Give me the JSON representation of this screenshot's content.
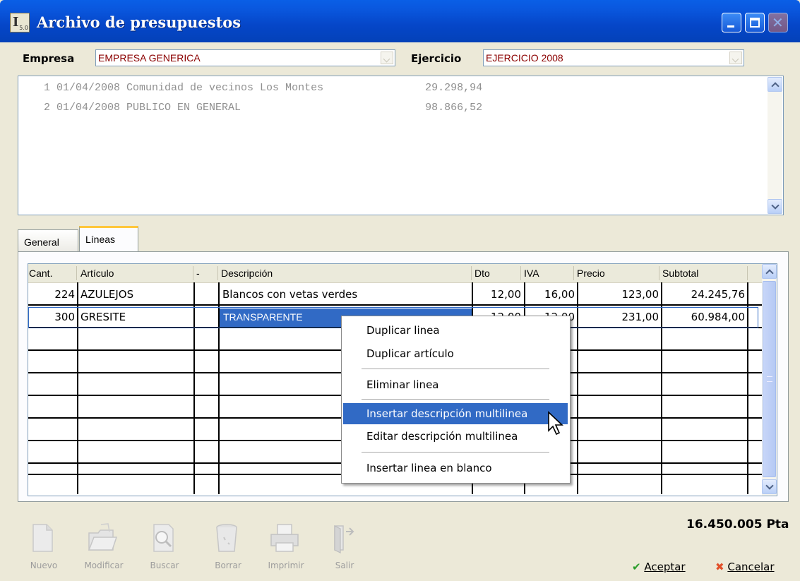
{
  "window": {
    "title": "Archivo de presupuestos",
    "app_icon_label": "I",
    "app_icon_badge": "5.0",
    "close_glyph": "✕"
  },
  "filters": {
    "empresa_label": "Empresa",
    "empresa_value": "EMPRESA GENERICA",
    "ejercicio_label": "Ejercicio",
    "ejercicio_value": "EJERCICIO 2008"
  },
  "budgets": [
    {
      "text": "    1 01/04/2008 Comunidad de vecinos Los Montes                29.298,94"
    },
    {
      "text": "    2 01/04/2008 PUBLICO EN GENERAL                             98.866,52"
    }
  ],
  "tabs": [
    {
      "label": "General",
      "active": false
    },
    {
      "label": "Líneas",
      "active": true
    }
  ],
  "grid": {
    "headers": [
      "Cant.",
      "Artículo",
      "-",
      "Descripción",
      "Dto",
      "IVA",
      "Precio",
      "Subtotal"
    ],
    "rows": [
      {
        "cant": "224",
        "articulo": "AZULEJOS",
        "descripcion": "Blancos con vetas verdes",
        "dto": "12,00",
        "iva": "16,00",
        "precio": "123,00",
        "subtotal": "24.245,76"
      },
      {
        "cant": "300",
        "articulo": "GRESITE",
        "descripcion": "TRANSPARENTE",
        "dto": "12,00",
        "iva": "12,00",
        "precio": "231,00",
        "subtotal": "60.984,00"
      }
    ]
  },
  "context_menu": {
    "items": [
      {
        "label": "Duplicar linea"
      },
      {
        "label": "Duplicar artículo"
      },
      {
        "label": "Eliminar linea"
      },
      {
        "label": "Insertar descripción multilinea",
        "highlighted": true
      },
      {
        "label": "Editar descripción multilinea"
      },
      {
        "label": "Insertar linea en blanco"
      }
    ]
  },
  "toolbar": {
    "nuevo": "Nuevo",
    "modificar": "Modificar",
    "buscar": "Buscar",
    "borrar": "Borrar",
    "imprimir": "Imprimir",
    "salir": "Salir"
  },
  "footer": {
    "total": "16.450.005 Pta",
    "aceptar": "Aceptar",
    "cancelar": "Cancelar"
  },
  "colors": {
    "titlebar": "#0A5FE6",
    "combo_text": "#8B0000",
    "selection": "#316AC5",
    "tab_accent": "#FFC73C"
  }
}
